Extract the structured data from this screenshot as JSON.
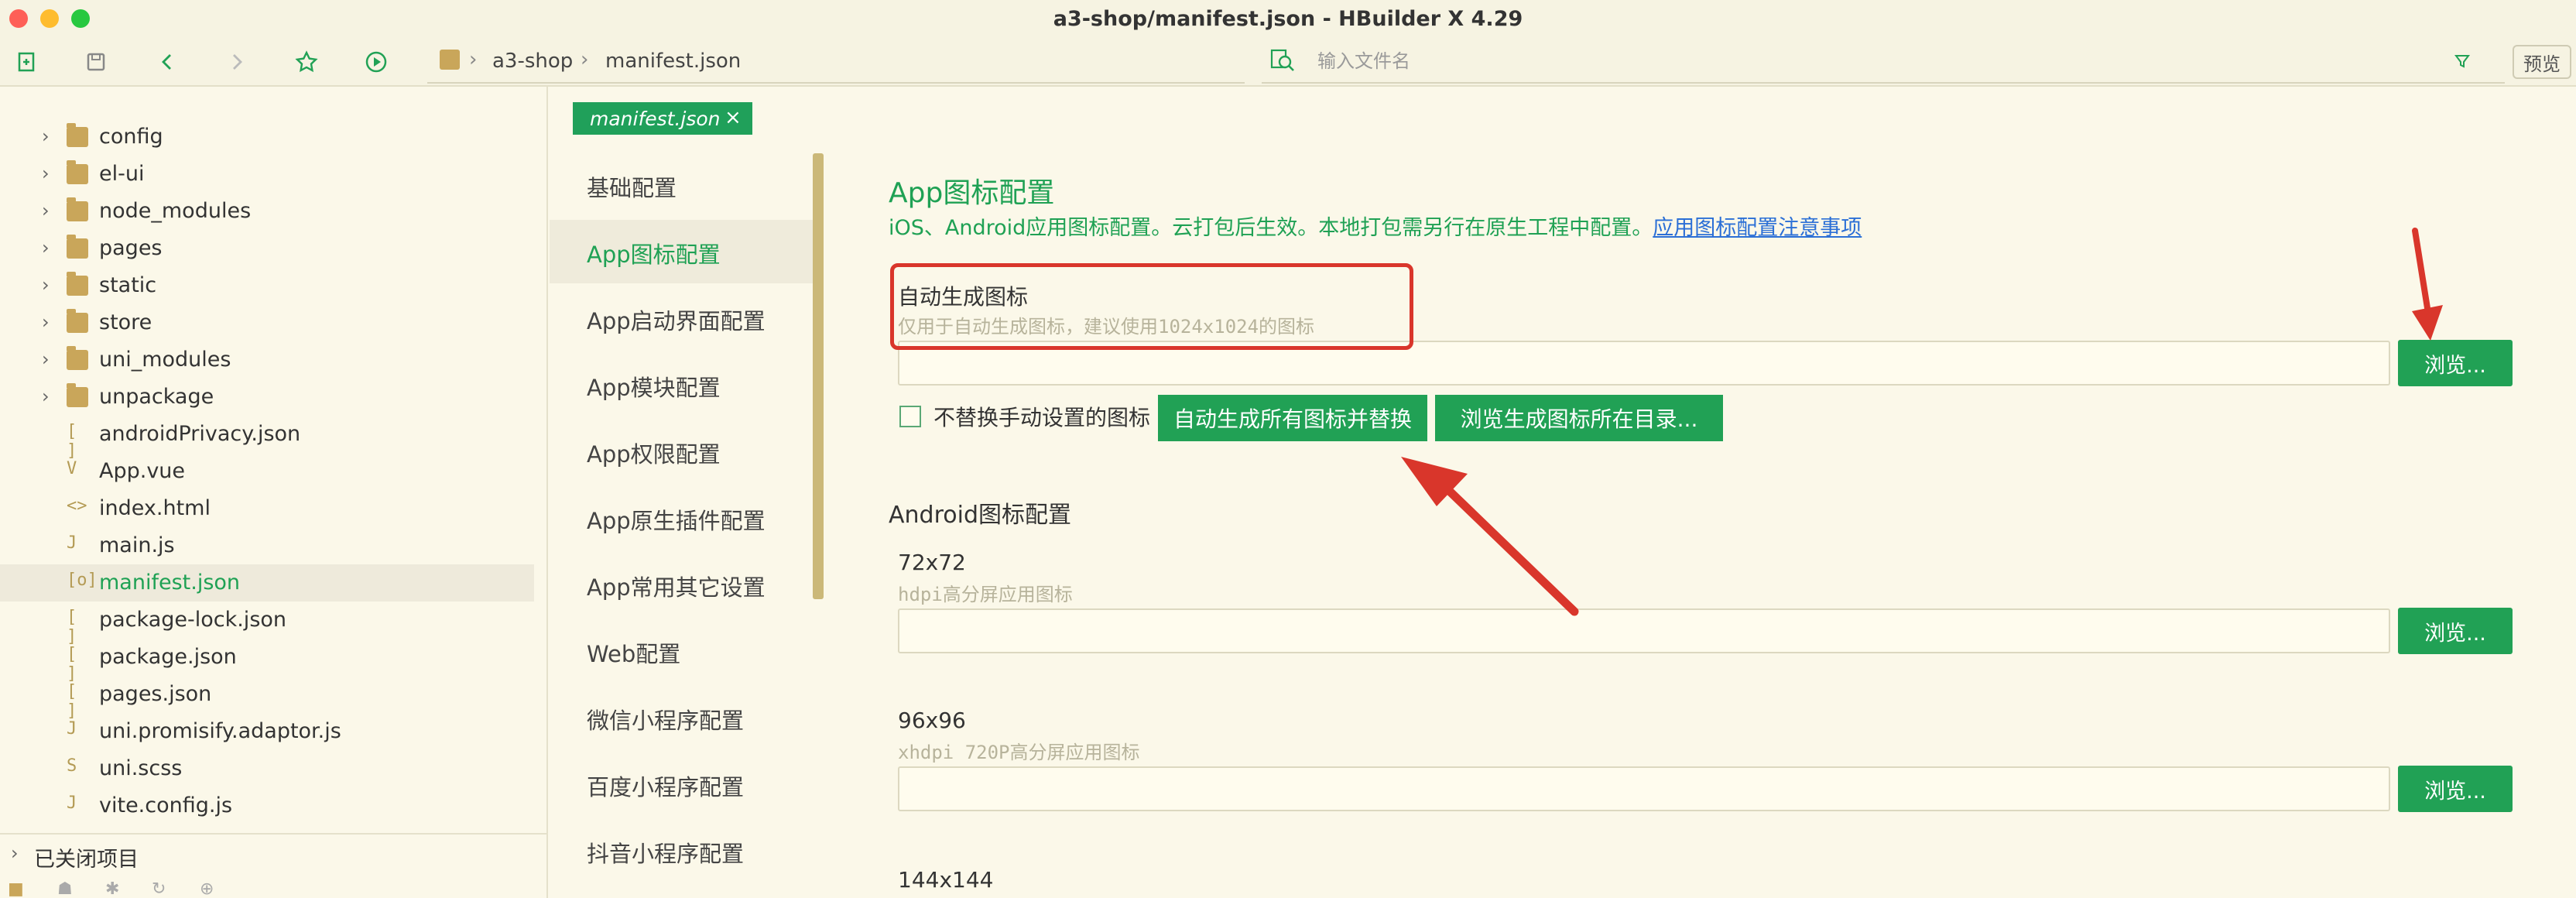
{
  "window": {
    "title": "a3-shop/manifest.json - HBuilder X 4.29"
  },
  "breadcrumb": {
    "project": "a3-shop",
    "file": "manifest.json"
  },
  "search": {
    "placeholder": "输入文件名"
  },
  "toolbar": {
    "preview_label": "预览"
  },
  "sidebar": {
    "items": [
      {
        "label": "config",
        "type": "folder"
      },
      {
        "label": "el-ui",
        "type": "folder"
      },
      {
        "label": "node_modules",
        "type": "folder"
      },
      {
        "label": "pages",
        "type": "folder"
      },
      {
        "label": "static",
        "type": "folder"
      },
      {
        "label": "store",
        "type": "folder"
      },
      {
        "label": "uni_modules",
        "type": "folder"
      },
      {
        "label": "unpackage",
        "type": "folder"
      },
      {
        "label": "androidPrivacy.json",
        "type": "json"
      },
      {
        "label": "App.vue",
        "type": "vue"
      },
      {
        "label": "index.html",
        "type": "html"
      },
      {
        "label": "main.js",
        "type": "js"
      },
      {
        "label": "manifest.json",
        "type": "manifest",
        "active": true
      },
      {
        "label": "package-lock.json",
        "type": "json"
      },
      {
        "label": "package.json",
        "type": "json"
      },
      {
        "label": "pages.json",
        "type": "json"
      },
      {
        "label": "uni.promisify.adaptor.js",
        "type": "js"
      },
      {
        "label": "uni.scss",
        "type": "scss"
      },
      {
        "label": "vite.config.js",
        "type": "js"
      }
    ],
    "closed_projects": "已关闭项目"
  },
  "tab": {
    "label": "manifest.json",
    "close": "×"
  },
  "config_nav": [
    {
      "label": "基础配置"
    },
    {
      "label": "App图标配置",
      "active": true
    },
    {
      "label": "App启动界面配置"
    },
    {
      "label": "App模块配置"
    },
    {
      "label": "App权限配置"
    },
    {
      "label": "App原生插件配置"
    },
    {
      "label": "App常用其它设置"
    },
    {
      "label": "Web配置"
    },
    {
      "label": "微信小程序配置"
    },
    {
      "label": "百度小程序配置"
    },
    {
      "label": "抖音小程序配置"
    }
  ],
  "main": {
    "title": "App图标配置",
    "desc": "iOS、Android应用图标配置。云打包后生效。本地打包需另行在原生工程中配置。",
    "desc_link": "应用图标配置注意事项",
    "auto": {
      "title": "自动生成图标",
      "sub": "仅用于自动生成图标，建议使用1024x1024的图标",
      "browse": "浏览..."
    },
    "no_replace_label": "不替换手动设置的图标",
    "gen_btn": "自动生成所有图标并替换",
    "browse_dir_btn": "浏览生成图标所在目录...",
    "android_title": "Android图标配置",
    "icons": [
      {
        "size": "72x72",
        "desc": "hdpi高分屏应用图标",
        "browse": "浏览..."
      },
      {
        "size": "96x96",
        "desc": "xhdpi 720P高分屏应用图标",
        "browse": "浏览..."
      },
      {
        "size": "144x144"
      }
    ]
  },
  "colors": {
    "accent": "#21a155",
    "annotation": "#d9362b",
    "link": "#2b6fd6"
  }
}
